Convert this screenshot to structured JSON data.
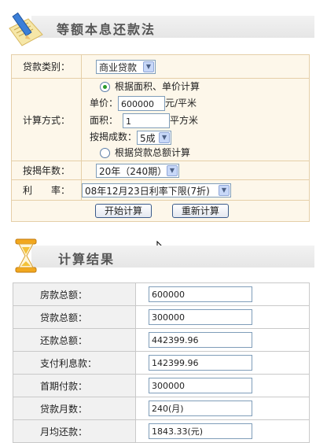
{
  "header1": {
    "title": "等额本息还款法"
  },
  "form": {
    "loan_type": {
      "label": "贷款类别：",
      "value": "商业贷款"
    },
    "calc_method": {
      "label": "计算方式：",
      "option_area": "根据面积、单价计算",
      "price_label": "单价：",
      "price_value": "600000",
      "price_unit": "元/平米",
      "area_label": "面积：",
      "area_value": "1",
      "area_unit": "平方米",
      "ratio_label": "按揭成数：",
      "ratio_value": "5成",
      "option_total": "根据贷款总额计算"
    },
    "years": {
      "label": "按揭年数：",
      "value": "20年（240期）"
    },
    "rate": {
      "label": "利　　率：",
      "value": "08年12月23日利率下限(7折)"
    },
    "buttons": {
      "start": "开始计算",
      "reset": "重新计算"
    }
  },
  "header2": {
    "title": "计算结果"
  },
  "results": [
    {
      "label": "房款总额：",
      "value": "600000"
    },
    {
      "label": "贷款总额：",
      "value": "300000"
    },
    {
      "label": "还款总额：",
      "value": "442399.96"
    },
    {
      "label": "支付利息款：",
      "value": "142399.96"
    },
    {
      "label": "首期付款：",
      "value": "300000"
    },
    {
      "label": "贷款月数：",
      "value": "240(月)"
    },
    {
      "label": "月均还款：",
      "value": "1843.33(元)"
    }
  ]
}
